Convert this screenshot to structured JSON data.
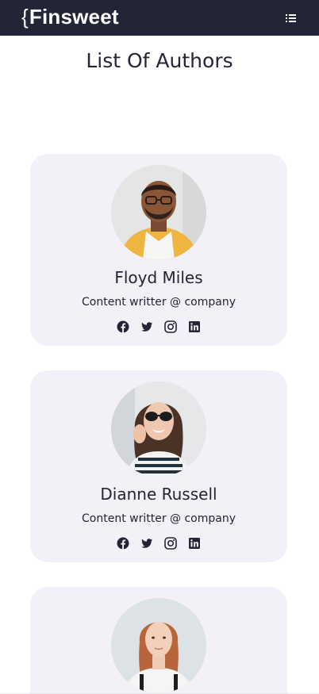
{
  "header": {
    "logo_brace": "{",
    "logo_text": "Finsweet",
    "menu_icon": "list-icon"
  },
  "page": {
    "title": "List Of Authors"
  },
  "authors": [
    {
      "name": "Floyd Miles",
      "role": "Content writter @ company",
      "socials": [
        "facebook-icon",
        "twitter-icon",
        "instagram-icon",
        "linkedin-icon"
      ]
    },
    {
      "name": "Dianne Russell",
      "role": "Content writter @ company",
      "socials": [
        "facebook-icon",
        "twitter-icon",
        "instagram-icon",
        "linkedin-icon"
      ]
    },
    {
      "name": "",
      "role": "",
      "socials": []
    }
  ],
  "colors": {
    "navbar": "#232536",
    "card_background": "#f4f0f8",
    "text": "#232536",
    "background": "#ffffff"
  }
}
